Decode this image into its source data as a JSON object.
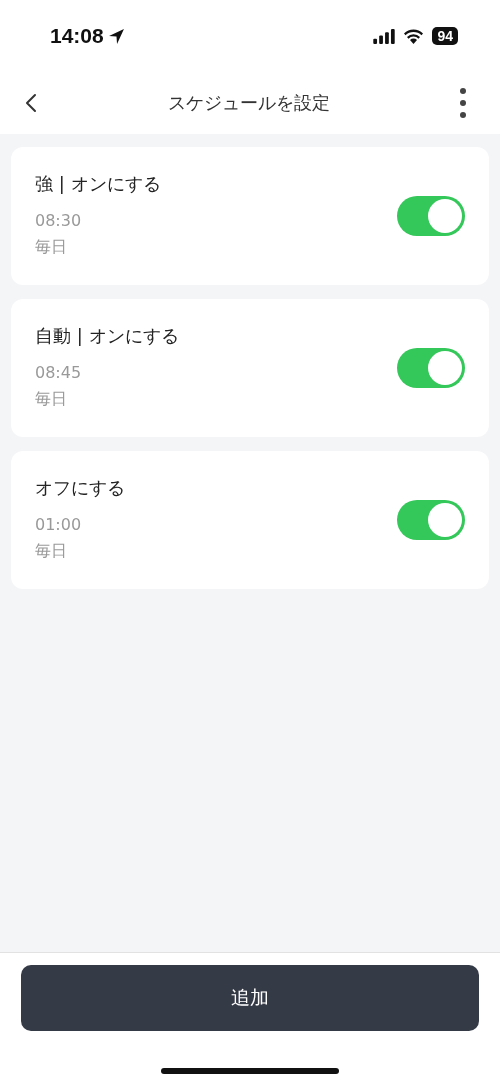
{
  "status_bar": {
    "time": "14:08",
    "battery": "94"
  },
  "nav_bar": {
    "title": "スケジュールを設定"
  },
  "schedules": [
    {
      "title": "強 | オンにする",
      "time": "08:30",
      "repeat": "毎日",
      "on": true
    },
    {
      "title": "自動 | オンにする",
      "time": "08:45",
      "repeat": "毎日",
      "on": true
    },
    {
      "title": "オフにする",
      "time": "01:00",
      "repeat": "毎日",
      "on": true
    }
  ],
  "add_button": "追加"
}
